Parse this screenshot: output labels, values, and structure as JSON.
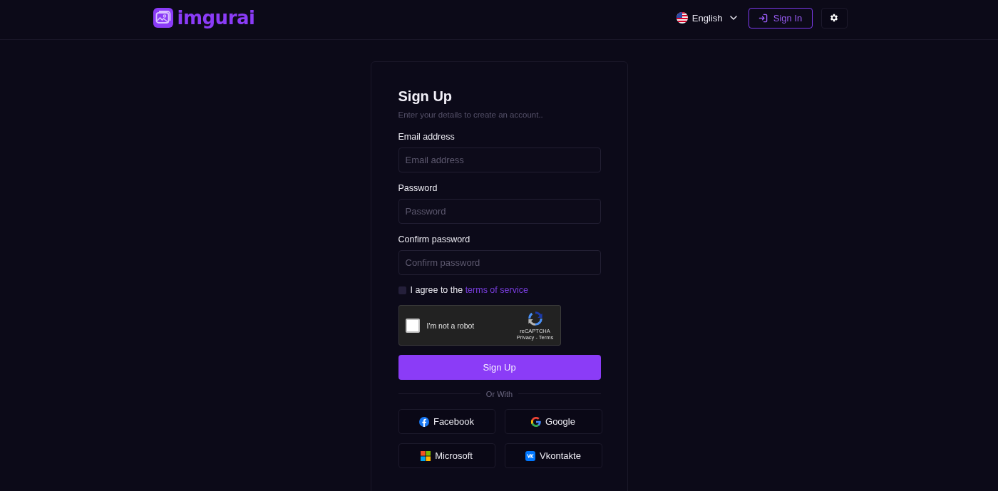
{
  "header": {
    "logo": "imgurai",
    "language": {
      "label": "English"
    },
    "sign_in": {
      "label": "Sign In"
    }
  },
  "form": {
    "title": "Sign Up",
    "subtitle": "Enter your details to create an account..",
    "fields": [
      {
        "label": "Email address",
        "placeholder": "Email address"
      },
      {
        "label": "Password",
        "placeholder": "Password"
      },
      {
        "label": "Confirm password",
        "placeholder": "Confirm password"
      }
    ],
    "terms": {
      "checked": false,
      "text": "I agree to the",
      "link": "terms of service"
    },
    "captcha": {
      "checked": false,
      "label": "I'm not a robot",
      "brand": "reCAPTCHA",
      "links": "Privacy - Terms"
    },
    "submit": {
      "label": "Sign Up"
    },
    "divider": "Or With",
    "social": [
      {
        "kind": "facebook",
        "label": "Facebook"
      },
      {
        "kind": "google",
        "label": "Google"
      },
      {
        "kind": "microsoft",
        "label": "Microsoft"
      },
      {
        "kind": "vk",
        "label": "Vkontakte"
      }
    ]
  }
}
